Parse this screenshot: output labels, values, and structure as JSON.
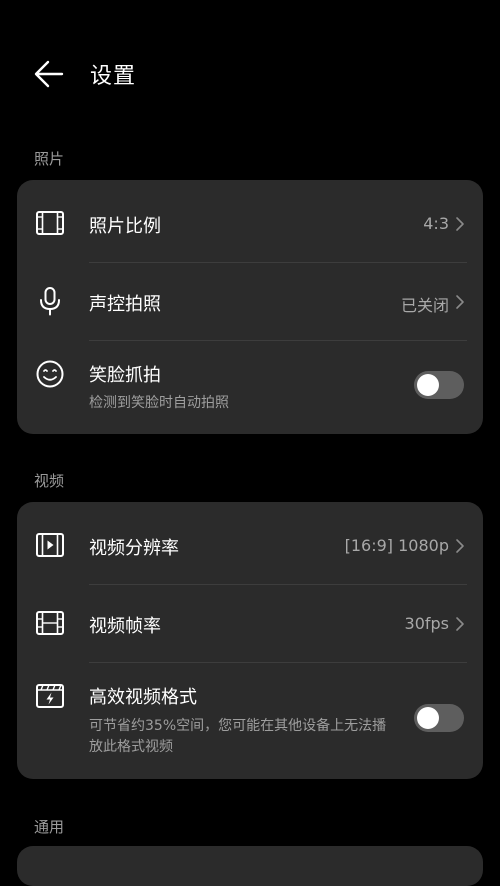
{
  "header": {
    "title": "设置"
  },
  "sections": {
    "photo": {
      "label": "照片",
      "aspect": {
        "label": "照片比例",
        "value": "4:3"
      },
      "voice": {
        "label": "声控拍照",
        "value": "已关闭"
      },
      "smile": {
        "label": "笑脸抓拍",
        "sub": "检测到笑脸时自动拍照",
        "enabled": false
      }
    },
    "video": {
      "label": "视频",
      "resolution": {
        "label": "视频分辨率",
        "value": "[16:9] 1080p"
      },
      "framerate": {
        "label": "视频帧率",
        "value": "30fps"
      },
      "efficient": {
        "label": "高效视频格式",
        "sub": "可节省约35%空间，您可能在其他设备上无法播放此格式视频",
        "enabled": false
      }
    },
    "general": {
      "label": "通用"
    }
  }
}
